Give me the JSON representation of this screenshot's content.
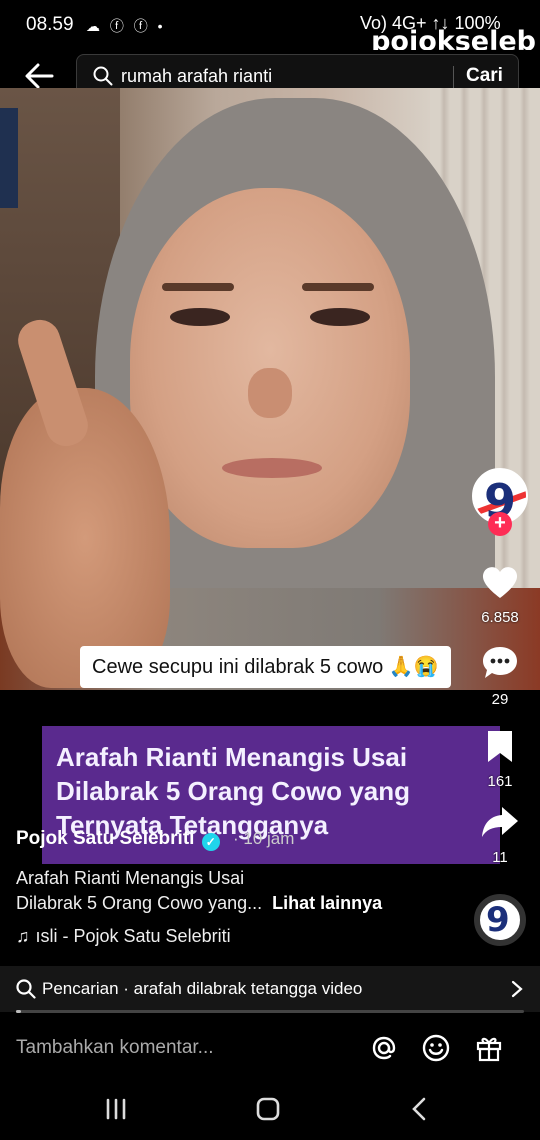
{
  "status": {
    "time": "08.59",
    "left_icons": "☁ ⓕ ⓕ •",
    "right_text": "Vo) 4G+ ↑↓ 100%",
    "battery": "100%"
  },
  "watermark": "pojokseleb",
  "search": {
    "query": "rumah arafah rianti",
    "button_label": "Cari"
  },
  "video": {
    "caption_overlay": "Cewe secupu ini dilabrak 5 cowo 🙏😭",
    "headline_lines": [
      "Arafah Rianti Menangis Usai",
      "Dilabrak 5 Orang Cowo yang",
      "Ternyata Tetangganya"
    ],
    "progress": 0.01
  },
  "rail": {
    "likes": "6.858",
    "comments": "29",
    "bookmarks": "161",
    "shares": "11"
  },
  "post": {
    "author": "Pojok Satu Selebriti",
    "time_ago": "· 10 jam",
    "description_line1": "Arafah Rianti Menangis Usai",
    "description_line2": "Dilabrak 5 Orang Cowo yang...",
    "see_more": "Lihat lainnya",
    "music": "ısli - Pojok Satu Selebriti"
  },
  "related_search": {
    "text": "Pencarian · arafah dilabrak tetangga video"
  },
  "comment": {
    "placeholder": "Tambahkan komentar..."
  },
  "icons": {
    "back": "back-arrow-icon",
    "search": "search-icon",
    "like": "heart-icon",
    "comment": "comment-bubble-icon",
    "bookmark": "bookmark-icon",
    "share": "share-arrow-icon",
    "mention": "at-icon",
    "emoji": "emoji-icon",
    "gift": "gift-icon"
  },
  "colors": {
    "accent_red": "#fe2c55",
    "headline_bg": "#5a2a8e",
    "verified": "#20d5ec"
  }
}
